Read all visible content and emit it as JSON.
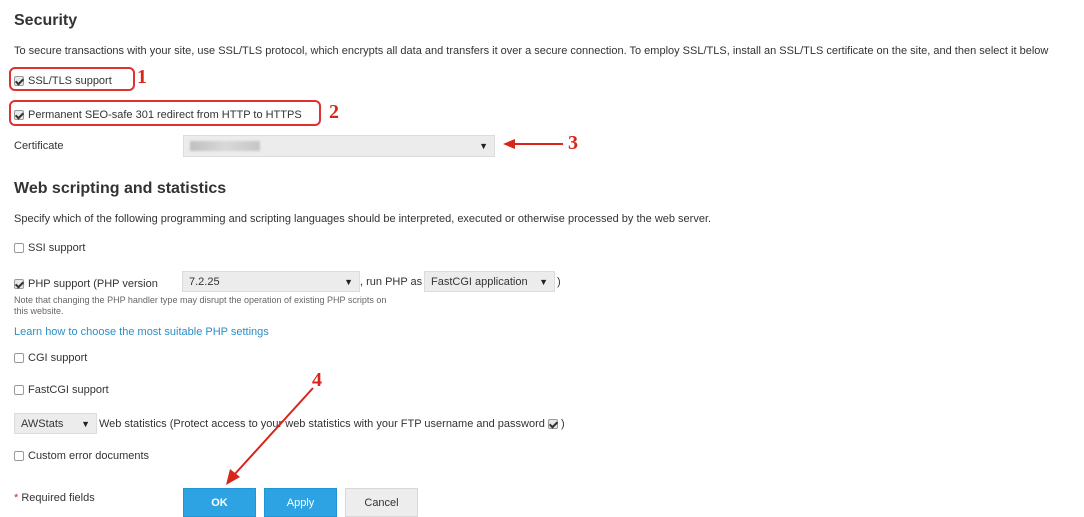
{
  "security": {
    "heading": "Security",
    "description": "To secure transactions with your site, use SSL/TLS protocol, which encrypts all data and transfers it over a secure connection. To employ SSL/TLS, install an SSL/TLS certificate on the site, and then select it below",
    "ssl_label": "SSL/TLS support",
    "ssl_checked": true,
    "redirect_label": "Permanent SEO-safe 301 redirect from HTTP to HTTPS",
    "redirect_checked": true,
    "certificate_label": "Certificate",
    "certificate_value": ""
  },
  "web": {
    "heading": "Web scripting and statistics",
    "description": "Specify which of the following programming and scripting languages should be interpreted, executed or otherwise processed by the web server.",
    "ssi_label": "SSI support",
    "php_label": "PHP support (PHP version",
    "php_version": "7.2.25",
    "run_php_as": ", run PHP as",
    "handler": "FastCGI application",
    "handler_close": ")",
    "php_note": "Note that changing the PHP handler type may disrupt the operation of existing PHP scripts on this website.",
    "php_link": "Learn how to choose the most suitable PHP settings",
    "cgi_label": "CGI support",
    "fastcgi_label": "FastCGI support",
    "stats_select": "AWStats",
    "stats_label": "Web statistics (Protect access to your web statistics with your FTP username and password",
    "stats_close": ")",
    "custom_errors_label": "Custom error documents"
  },
  "footer": {
    "required_star": "*",
    "required_text": " Required fields",
    "ok": "OK",
    "apply": "Apply",
    "cancel": "Cancel"
  },
  "annotations": {
    "n1": "1",
    "n2": "2",
    "n3": "3",
    "n4": "4",
    "color": "#e0302f"
  }
}
